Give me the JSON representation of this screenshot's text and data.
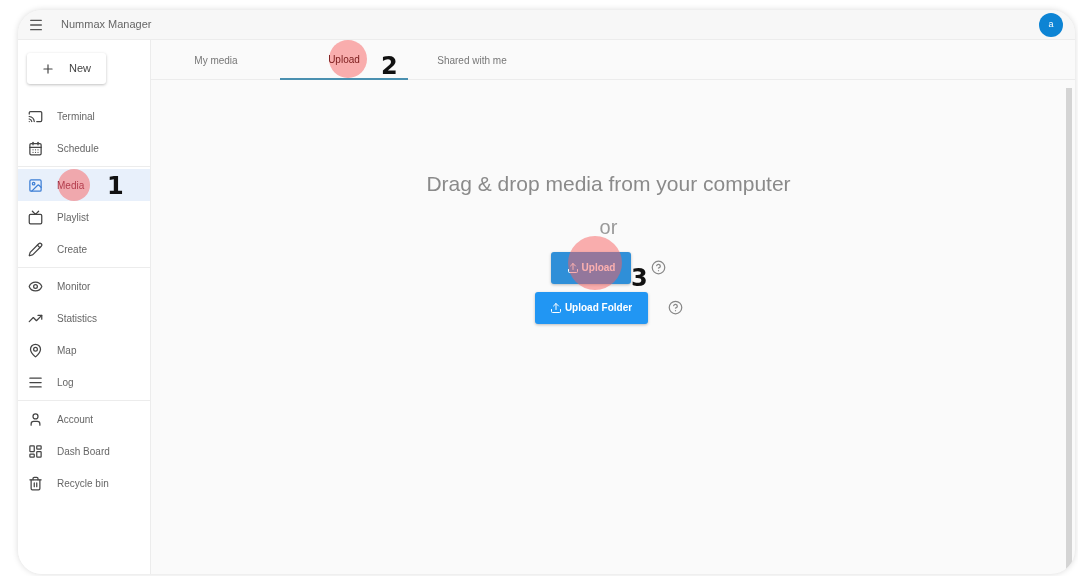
{
  "app_bar": {
    "title": "Nummax Manager",
    "avatar": "a"
  },
  "new_button": {
    "label": "New"
  },
  "sidebar": {
    "groups": [
      {
        "items": [
          {
            "label": "Terminal",
            "selected": false
          },
          {
            "label": "Schedule",
            "selected": false
          }
        ]
      },
      {
        "items": [
          {
            "label": "Media",
            "selected": true
          },
          {
            "label": "Playlist",
            "selected": false
          },
          {
            "label": "Create",
            "selected": false
          }
        ]
      },
      {
        "items": [
          {
            "label": "Monitor",
            "selected": false
          },
          {
            "label": "Statistics",
            "selected": false
          },
          {
            "label": "Map",
            "selected": false
          },
          {
            "label": "Log",
            "selected": false
          }
        ]
      },
      {
        "items": [
          {
            "label": "Account",
            "selected": false
          },
          {
            "label": "Dash Board",
            "selected": false
          },
          {
            "label": "Recycle bin",
            "selected": false
          }
        ]
      }
    ]
  },
  "tabs": [
    {
      "label": "My media",
      "selected": false
    },
    {
      "label": "Upload",
      "selected": true
    },
    {
      "label": "Shared with me",
      "selected": false
    }
  ],
  "dropzone": {
    "heading": "Drag & drop media from your computer",
    "separator": "or",
    "buttons": [
      {
        "label": "Upload"
      },
      {
        "label": "Upload Folder"
      }
    ]
  },
  "annotations": [
    {
      "number": "1"
    },
    {
      "number": "2"
    },
    {
      "number": "3"
    }
  ]
}
